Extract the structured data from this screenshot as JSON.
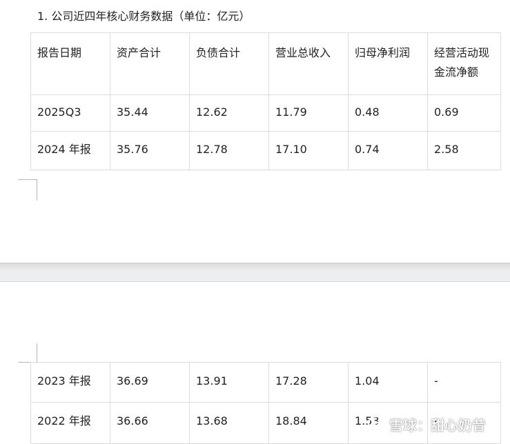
{
  "heading": "1.  公司近四年核心财务数据（单位：亿元）",
  "columns": [
    "报告日期",
    "资产合计",
    "负债合计",
    "营业总收入",
    "归母净利润",
    "经营活动现金流净额"
  ],
  "rows_page1": [
    [
      "2025Q3",
      "35.44",
      "12.62",
      "11.79",
      "0.48",
      "0.69"
    ],
    [
      "2024 年报",
      "35.76",
      "12.78",
      "17.10",
      "0.74",
      "2.58"
    ]
  ],
  "rows_page2": [
    [
      "2023 年报",
      "36.69",
      "13.91",
      "17.28",
      "1.04",
      "-"
    ],
    [
      "2022 年报",
      "36.66",
      "13.68",
      "18.84",
      "1.53",
      "-"
    ]
  ],
  "watermark": {
    "logo_icon": "snowball-logo-icon",
    "text": "雪球：甜心奶昔"
  }
}
